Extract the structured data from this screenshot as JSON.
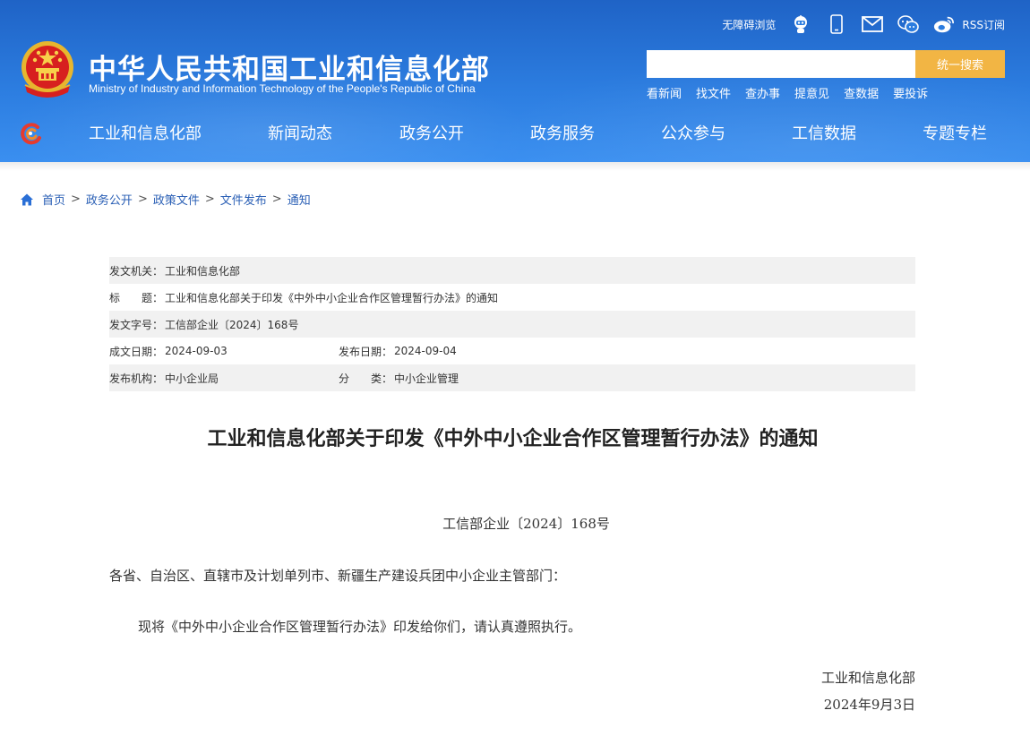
{
  "header": {
    "title_cn": "中华人民共和国工业和信息化部",
    "title_en": "Ministry of Industry and Information Technology of the People's Republic of China",
    "emblem_icon": "national-emblem-icon",
    "top_links": {
      "accessibility": "无障碍浏览",
      "rss": "RSS订阅",
      "icons": [
        "robot-assistant-icon",
        "mobile-phone-icon",
        "mail-icon",
        "wechat-icon",
        "weibo-icon"
      ]
    },
    "search": {
      "value": "",
      "button_label": "统一搜索"
    },
    "quick_links": [
      "看新闻",
      "找文件",
      "查办事",
      "提意见",
      "查数据",
      "要投诉"
    ],
    "nav": [
      "工业和信息化部",
      "新闻动态",
      "政务公开",
      "政务服务",
      "公众参与",
      "工信数据",
      "专题专栏"
    ],
    "colors": {
      "header_blue": "#2c7de0",
      "search_button": "#f2b544",
      "link_blue": "#2a5fb5"
    }
  },
  "breadcrumb": [
    "首页",
    "政务公开",
    "政策文件",
    "文件发布",
    "通知"
  ],
  "meta": {
    "issuer": {
      "label": "发文机关：",
      "value": "工业和信息化部"
    },
    "title": {
      "label": "标　　题：",
      "value": "工业和信息化部关于印发《中外中小企业合作区管理暂行办法》的通知"
    },
    "doc_no": {
      "label": "发文字号：",
      "value": "工信部企业〔2024〕168号"
    },
    "written_date": {
      "label": "成文日期：",
      "value": "2024-09-03"
    },
    "publish_date": {
      "label": "发布日期：",
      "value": "2024-09-04"
    },
    "agency": {
      "label": "发布机构：",
      "value": "中小企业局"
    },
    "category": {
      "label": "分　　类：",
      "value": "中小企业管理"
    }
  },
  "article": {
    "title": "工业和信息化部关于印发《中外中小企业合作区管理暂行办法》的通知",
    "doc_number": "工信部企业〔2024〕168号",
    "salutation": "各省、自治区、直辖市及计划单列市、新疆生产建设兵团中小企业主管部门：",
    "body": "现将《中外中小企业合作区管理暂行办法》印发给你们，请认真遵照执行。",
    "signature_org": "工业和信息化部",
    "signature_date": "2024年9月3日"
  }
}
